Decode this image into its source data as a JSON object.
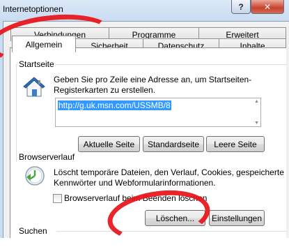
{
  "window": {
    "title": "Internetoptionen"
  },
  "titlebar_buttons": {
    "help": "?",
    "close": "✕"
  },
  "tabs": {
    "row_back": [
      "Verbindungen",
      "Programme",
      "Erweitert"
    ],
    "row_front": [
      "Allgemein",
      "Sicherheit",
      "Datenschutz",
      "Inhalte"
    ],
    "active": "Allgemein"
  },
  "startseite": {
    "label": "Startseite",
    "icon": "house-icon",
    "description_line1": "Geben Sie pro Zeile eine Adresse an, um Startseiten-",
    "description_line2": "Registerkarten zu erstellen.",
    "url": "http://g.uk.msn.com/USSMB/8",
    "buttons": [
      "Aktuelle Seite",
      "Standardseite",
      "Leere Seite"
    ]
  },
  "browserverlauf": {
    "label": "Browserverlauf",
    "icon": "history-clock-icon",
    "description_line1": "Löscht temporäre Dateien, den Verlauf, Cookies, gespeicherte",
    "description_line2": "Kennwörter und Webformularinformationen.",
    "checkbox_label": "Browserverlauf beim Beenden löschen",
    "checkbox_checked": false,
    "buttons": [
      "Löschen...",
      "Einstellungen"
    ]
  },
  "suchen": {
    "label": "Suchen"
  },
  "colors": {
    "annotation_red": "#e8151b",
    "selection": "#3399ff"
  }
}
